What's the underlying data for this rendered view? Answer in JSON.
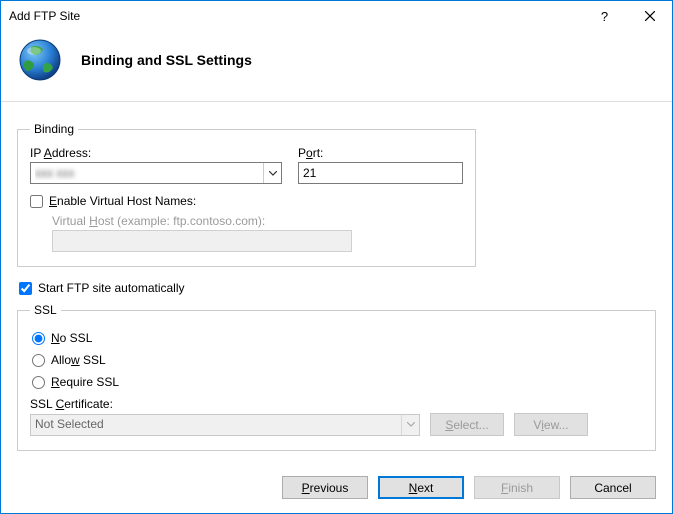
{
  "window": {
    "title": "Add FTP Site"
  },
  "header": {
    "title": "Binding and SSL Settings"
  },
  "binding": {
    "legend": "Binding",
    "ip_label": "IP Address:",
    "ip_value": "xxx xxx",
    "port_label": "Port:",
    "port_value": "21",
    "enable_vh_label": "Enable Virtual Host Names:",
    "enable_vh_checked": false,
    "vh_label": "Virtual Host (example: ftp.contoso.com):",
    "vh_value": ""
  },
  "auto": {
    "label": "Start FTP site automatically",
    "checked": true
  },
  "ssl": {
    "legend": "SSL",
    "no_ssl": "No SSL",
    "allow_ssl": "Allow SSL",
    "require_ssl": "Require SSL",
    "selected": "no",
    "cert_label": "SSL Certificate:",
    "cert_value": "Not Selected",
    "select_btn": "Select...",
    "view_btn": "View..."
  },
  "footer": {
    "previous": "Previous",
    "next": "Next",
    "finish": "Finish",
    "cancel": "Cancel"
  }
}
